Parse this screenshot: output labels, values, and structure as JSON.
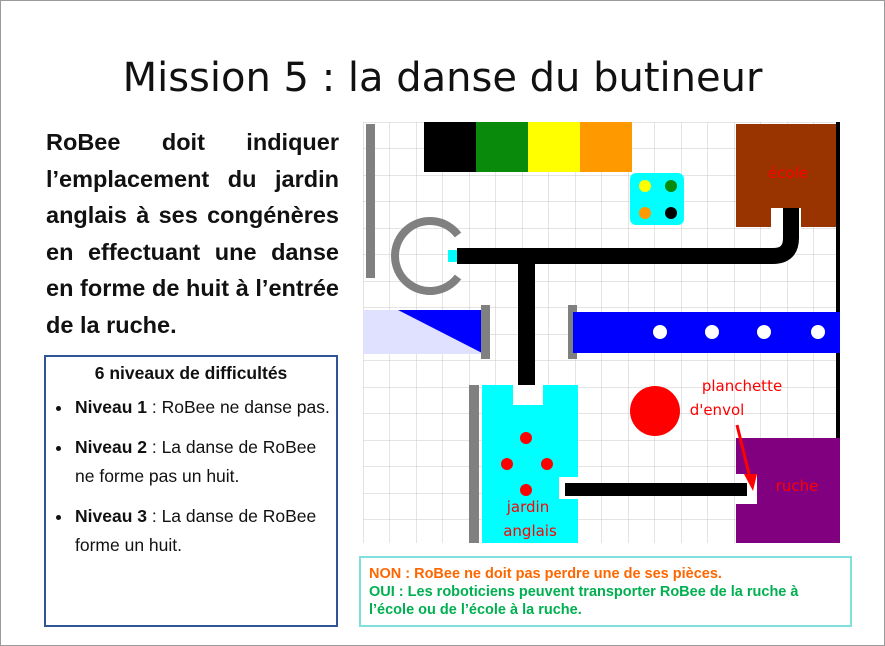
{
  "title": "Mission 5 : la danse du butineur",
  "intro": "RoBee doit indiquer l’emplacement du jardin anglais à ses congénères en effectuant une danse en forme de huit à l’entrée de la ruche.",
  "levels_box": {
    "heading": "6 niveaux de difficultés",
    "items": [
      {
        "level": "Niveau 1",
        "text": " : RoBee ne danse pas."
      },
      {
        "level": "Niveau 2",
        "text": " : La danse de RoBee ne forme pas un huit."
      },
      {
        "level": "Niveau 3",
        "text": " : La danse de RoBee forme un huit."
      }
    ]
  },
  "board": {
    "labels": {
      "ecole": "école",
      "ruche": "ruche",
      "planchette_line1": "planchette",
      "planchette_line2": "d'envol",
      "jardin_line1": "jardin",
      "jardin_line2": "anglais"
    },
    "colors": {
      "strip": [
        "#000000",
        "#0a8a0a",
        "#ffff00",
        "#ff9900"
      ],
      "ecole": "#993300",
      "ruche": "#800080",
      "jardin": "#00ffff",
      "wall": "#0000ff",
      "flower_red": "#ff0000",
      "label_red": "#ff0000"
    }
  },
  "notes": {
    "non": "NON : RoBee ne doit pas perdre une de ses pièces.",
    "oui": "OUI : Les roboticiens peuvent transporter RoBee de la ruche à l’école ou de l’école à la ruche."
  }
}
